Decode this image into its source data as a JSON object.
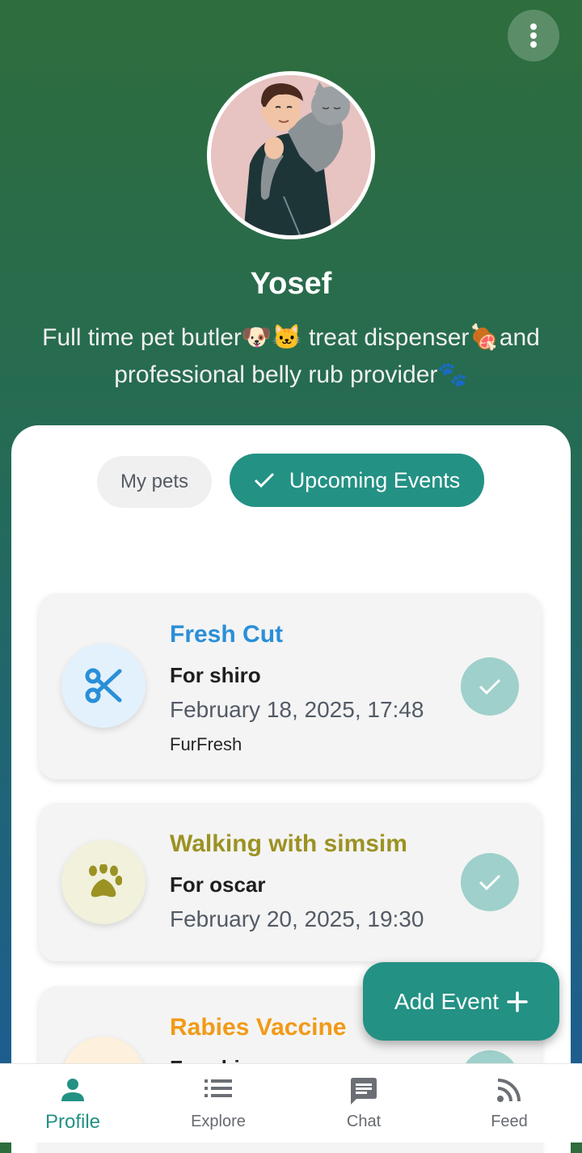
{
  "profile": {
    "name": "Yosef",
    "bio": "Full time pet butler🐶🐱 treat dispenser🍖and professional belly rub provider🐾"
  },
  "tabs": {
    "my_pets": "My pets",
    "upcoming_events": "Upcoming Events",
    "selected": "upcoming_events"
  },
  "events": [
    {
      "title": "Fresh Cut",
      "for": "For shiro",
      "date": "February 18, 2025, 17:48",
      "provider": "FurFresh",
      "icon": "scissors-icon",
      "color": "#2a8fd8",
      "icon_bg": "#e3f1fc"
    },
    {
      "title": "Walking with simsim",
      "for": "For oscar",
      "date": "February 20, 2025, 19:30",
      "provider": "",
      "icon": "paw-icon",
      "color": "#9b9223",
      "icon_bg": "#f1f1dc"
    },
    {
      "title": "Rabies Vaccine",
      "for": "For shiro",
      "date": "",
      "provider": "",
      "icon": "vaccine-icon",
      "color": "#f29a16",
      "icon_bg": "#fdf0dc"
    }
  ],
  "fab": {
    "label": "Add Event",
    "icon": "plus-icon"
  },
  "nav": [
    {
      "label": "Profile",
      "icon": "person-icon",
      "active": true
    },
    {
      "label": "Explore",
      "icon": "list-icon",
      "active": false
    },
    {
      "label": "Chat",
      "icon": "chat-icon",
      "active": false
    },
    {
      "label": "Feed",
      "icon": "rss-icon",
      "active": false
    }
  ],
  "colors": {
    "accent": "#239184",
    "header_top": "#2e6d3c",
    "header_bottom": "#1c5c96"
  }
}
